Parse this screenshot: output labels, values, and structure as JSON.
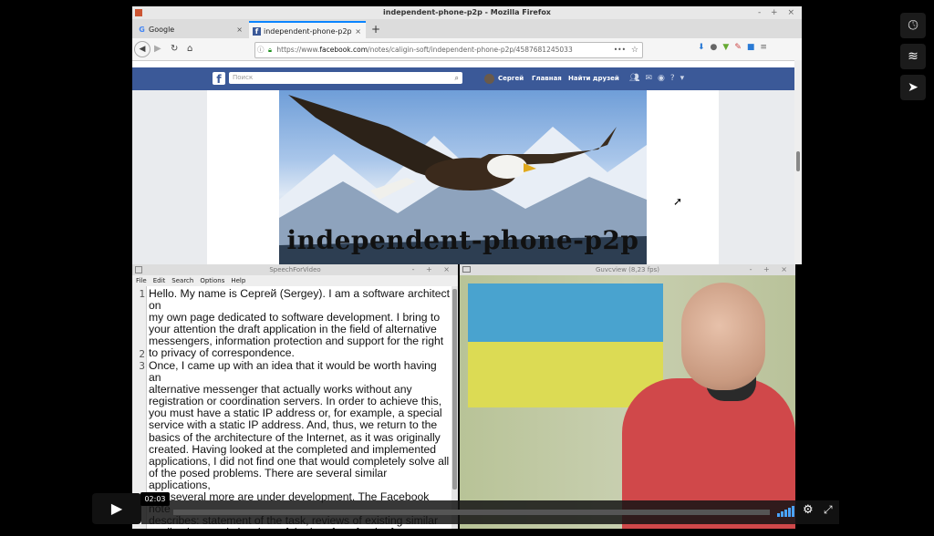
{
  "firefox": {
    "window_title": "independent-phone-p2p - Mozilla Firefox",
    "window_buttons": "- + ×",
    "tabs": [
      {
        "label": "Google",
        "icon": "G",
        "close": "×"
      },
      {
        "label": "independent-phone-p2p",
        "icon": "f",
        "close": "×"
      }
    ],
    "new_tab": "+",
    "url_prefix": "https://www.",
    "url_domain": "facebook.com",
    "url_rest": "/notes/caligin-soft/independent-phone-p2p/4587681245033",
    "url_menu": "•••",
    "url_star": "☆",
    "accent_color": "#0a84ff"
  },
  "facebook": {
    "logo": "f",
    "search_placeholder": "Поиск",
    "user_name": "Сергей",
    "link_home": "Главная",
    "link_find_friends": "Найти друзей",
    "brand_color": "#3b5998"
  },
  "banner": {
    "title": "independent-phone-p2p"
  },
  "editor": {
    "window_title": "SpeechForVideo",
    "window_buttons": "- + ×",
    "menu": [
      "File",
      "Edit",
      "Search",
      "Options",
      "Help"
    ],
    "lines": [
      {
        "num": "1",
        "text": "Hello. My name is Сергей (Sergey). I am a software architect on\nmy own page dedicated to software development. I bring to\nyour attention the draft application in the field of alternative\nmessengers, information protection and support for the right\nto privacy of correspondence."
      },
      {
        "num": "2",
        "text": ""
      },
      {
        "num": "3",
        "text": "Once, I came up with an idea that it would be worth having an\nalternative messenger that actually works without any\nregistration or coordination servers. In order to achieve this,\nyou must have a static IP address or, for example, a special\nservice with a static IP address. And, thus, we return to the\nbasics of the architecture of the Internet, as it was originally\ncreated. Having looked at the completed and implemented\napplications, I did not find one that would completely solve all\nof the posed problems. There are several similar applications,\nand several more are under development. The Facebook note\ndescribes: statement of the task, reviews of existing similar\napplications and sketches of the interface for the future\napplication."
      }
    ]
  },
  "camview": {
    "window_title": "Guvcview  (8,23 fps)",
    "window_buttons": "- + ×",
    "flag_colors": [
      "#49a3cf",
      "#dcdb54"
    ]
  },
  "player": {
    "current_time": "02:03",
    "progress_fraction": 0.0,
    "accent_color": "#4aa3ff"
  }
}
